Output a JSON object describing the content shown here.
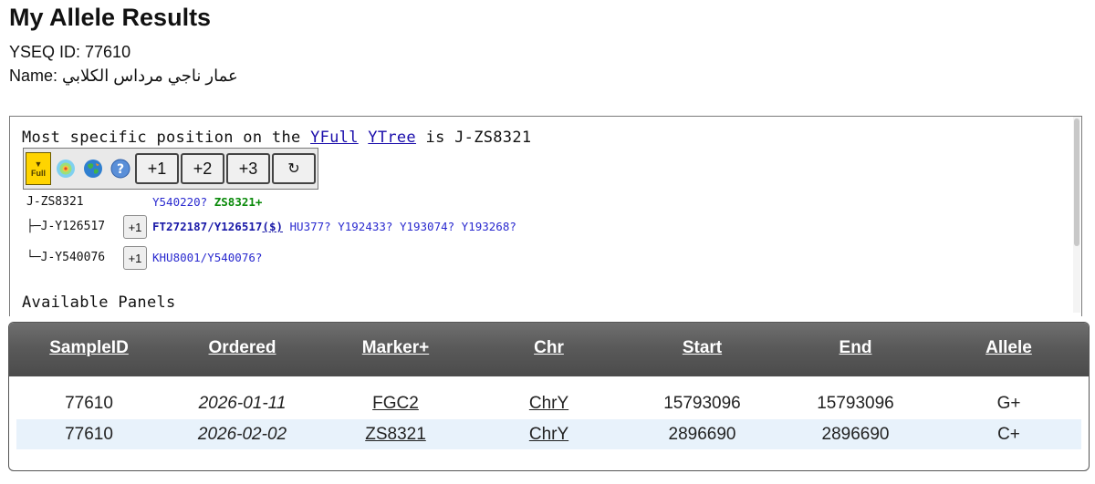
{
  "header": {
    "title": "My Allele Results",
    "yseq_line": "YSEQ ID: 77610",
    "name_line": "Name: عمار ناجي مرداس الكلابي"
  },
  "tree_panel": {
    "specific_prefix": "Most specific position on the",
    "link_yfull": "YFull",
    "link_ytree": "YTree",
    "specific_suffix": "is J-ZS8321",
    "toolbar": {
      "full_arrow": "▼",
      "full_label": "Full",
      "btn_plus1": "+1",
      "btn_plus2": "+2",
      "btn_plus3": "+3",
      "btn_refresh": "↻"
    },
    "nodes": [
      {
        "label": "J-ZS8321",
        "snp_a": "Y540220?",
        "snp_b": "ZS8321+"
      },
      {
        "label": "├─J-Y126517",
        "button": "+1",
        "snp_a": "FT272187/Y126517",
        "snp_dollar": "($)",
        "snp_b": "HU377? Y192433? Y193074? Y193268?"
      },
      {
        "label": "└─J-Y540076",
        "button": "+1",
        "snp_a": "KHU8001/Y540076?"
      }
    ],
    "available_panels": "Available Panels"
  },
  "table": {
    "columns": [
      "SampleID",
      "Ordered",
      "Marker+",
      "Chr",
      "Start",
      "End",
      "Allele"
    ],
    "rows": [
      [
        "77610",
        "2026-01-11",
        "FGC2",
        "ChrY",
        "15793096",
        "15793096",
        "G+"
      ],
      [
        "77610",
        "2026-02-02",
        "ZS8321",
        "ChrY",
        "2896690",
        "2896690",
        "C+"
      ]
    ]
  },
  "colors": {
    "header_bg": "#5a5a5a",
    "alt_row": "#e8f2fb",
    "link": "#1a0dab",
    "snp_blue": "#2a2acf",
    "snp_green": "#0a8a0a",
    "full_button": "#ffd400"
  }
}
